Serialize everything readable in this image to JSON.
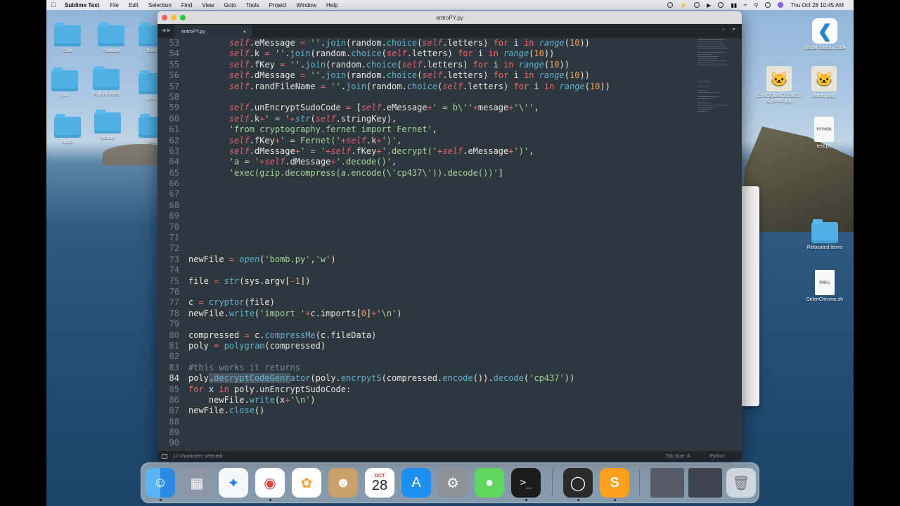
{
  "menubar": {
    "app_name": "Sublime Text",
    "items": [
      "File",
      "Edit",
      "Selection",
      "Find",
      "View",
      "Goto",
      "Tools",
      "Project",
      "Window",
      "Help"
    ],
    "clock": "Thu Oct 28  10:45 AM"
  },
  "desktop": {
    "left_icons": [
      {
        "label": "Site"
      },
      {
        "label": "Youtube"
      },
      {
        "label": "bitco"
      },
      {
        "label": "c++"
      },
      {
        "label": "Python-files"
      },
      {
        "label": "iphon"
      },
      {
        "label": "tools"
      },
      {
        "label": "school"
      },
      {
        "label": "java"
      }
    ],
    "right_icons": [
      {
        "label": "Visual Studio Code"
      },
      {
        "label": "CsHOQuYiEi02WEc d_small.jpg"
      },
      {
        "label": "bomb.jpeg"
      },
      {
        "label": "test.py"
      },
      {
        "label": "Relocated Items"
      },
      {
        "label": "SelenChrome.sh"
      }
    ],
    "doc_badges": {
      "python": "PYTHON",
      "shell": "SHELL"
    }
  },
  "window": {
    "title": "entroPY.py",
    "tab": "entroPY.py"
  },
  "editor": {
    "active_line": "84",
    "line_numbers": [
      "53",
      "54",
      "55",
      "56",
      "57",
      "58",
      "59",
      "60",
      "61",
      "62",
      "63",
      "64",
      "65",
      "66",
      "67",
      "68",
      "69",
      "70",
      "71",
      "72",
      "73",
      "74",
      "75",
      "76",
      "77",
      "78",
      "79",
      "80",
      "81",
      "82",
      "83",
      "84",
      "85",
      "86",
      "87",
      "88",
      "89",
      "90"
    ]
  },
  "status": {
    "left": "17 characters selected",
    "tab_size": "Tab Size: 4",
    "syntax": "Python"
  },
  "dock": {
    "calendar_month": "OCT",
    "calendar_day": "28"
  },
  "colors": {
    "editor_bg": "#2e363e",
    "keyword": "#e0616f",
    "string": "#a5d49c",
    "function": "#5fb4ce",
    "number": "#f0a15a"
  }
}
